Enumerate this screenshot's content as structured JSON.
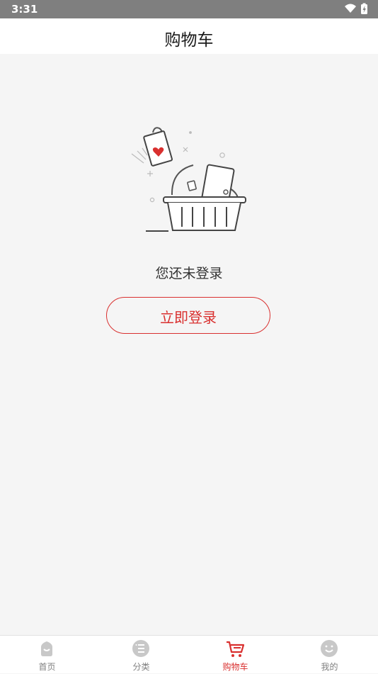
{
  "status_bar": {
    "time": "3:31"
  },
  "header": {
    "title": "购物车"
  },
  "empty_state": {
    "message": "您还未登录",
    "login_button_label": "立即登录"
  },
  "tab_bar": {
    "active_color": "#d9302f",
    "inactive_color": "#bfbfbf",
    "items": [
      {
        "label": "首页",
        "icon": "home-icon",
        "active": false
      },
      {
        "label": "分类",
        "icon": "category-icon",
        "active": false
      },
      {
        "label": "购物车",
        "icon": "cart-icon",
        "active": true
      },
      {
        "label": "我的",
        "icon": "profile-smiley-icon",
        "active": false
      }
    ]
  }
}
